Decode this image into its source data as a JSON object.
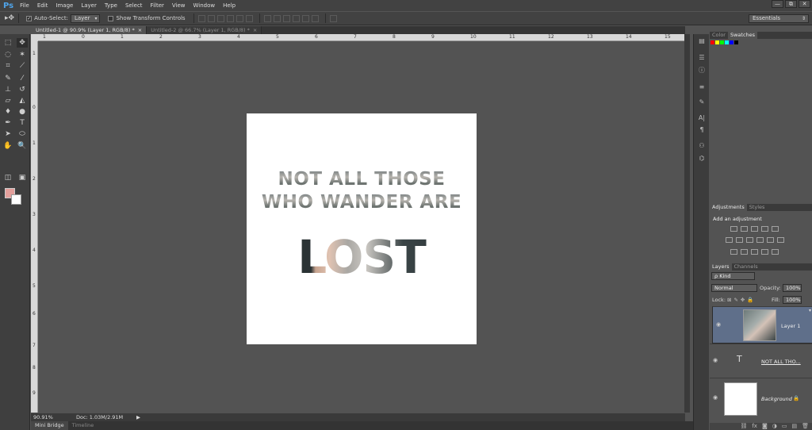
{
  "app": {
    "logo": "Ps"
  },
  "menu": [
    "File",
    "Edit",
    "Image",
    "Layer",
    "Type",
    "Select",
    "Filter",
    "View",
    "Window",
    "Help"
  ],
  "window_buttons": [
    "—",
    "⧉",
    "✕"
  ],
  "options": {
    "auto_select_label": "Auto-Select:",
    "auto_select_value": "Layer",
    "transform_label": "Show Transform Controls",
    "workspace": "Essentials"
  },
  "tabs": [
    {
      "label": "Untitled-1 @ 90.9% (Layer 1, RGB/8) *",
      "close": "×"
    },
    {
      "label": "Untitled-2 @ 66.7% (Layer 1, RGB/8) *",
      "close": "×"
    }
  ],
  "ruler_top": [
    "1",
    "0",
    "1",
    "2",
    "3",
    "4",
    "5",
    "6",
    "7",
    "8",
    "9",
    "10",
    "11",
    "12",
    "13",
    "14",
    "15"
  ],
  "ruler_left": [
    "1",
    "0",
    "1",
    "2",
    "3",
    "4",
    "5",
    "6",
    "7",
    "8",
    "9"
  ],
  "canvas": {
    "line1": "NOT ALL THOSE",
    "line2": "WHO WANDER ARE",
    "big": "LOST"
  },
  "status": {
    "zoom": "90.91%",
    "doc": "Doc: 1.03M/2.91M",
    "arrow": "▶"
  },
  "bottom_tabs": [
    "Mini Bridge",
    "Timeline"
  ],
  "panels": {
    "color_tabs": [
      "Color",
      "Swatches"
    ],
    "swatch_colors": [
      "#ff0000",
      "#ffff00",
      "#00ff00",
      "#00ffff",
      "#0000ff",
      "#000000"
    ],
    "adjust_tabs": [
      "Adjustments",
      "Styles"
    ],
    "adjust_title": "Add an adjustment",
    "layers_tabs": [
      "Layers",
      "Channels"
    ],
    "kind": "Kind",
    "kind_prefix": "ρ",
    "blend_mode": "Normal",
    "opacity_label": "Opacity:",
    "opacity_value": "100%",
    "lock_label": "Lock:",
    "fill_label": "Fill:",
    "fill_value": "100%",
    "layers": [
      {
        "name": "Layer 1",
        "type": "image",
        "selected": true
      },
      {
        "name": "NOT ALL THO...",
        "type": "text",
        "thumb_glyph": "T"
      },
      {
        "name": "Background",
        "type": "bg",
        "lock": "🔒"
      }
    ],
    "footer_icons": [
      "⛓",
      "fx",
      "◙",
      "◑",
      "▭",
      "▤",
      "🗑"
    ]
  },
  "colors": {
    "foreground": "#e4a09c",
    "background": "#ffffff",
    "accent": "#4fa3e8"
  }
}
